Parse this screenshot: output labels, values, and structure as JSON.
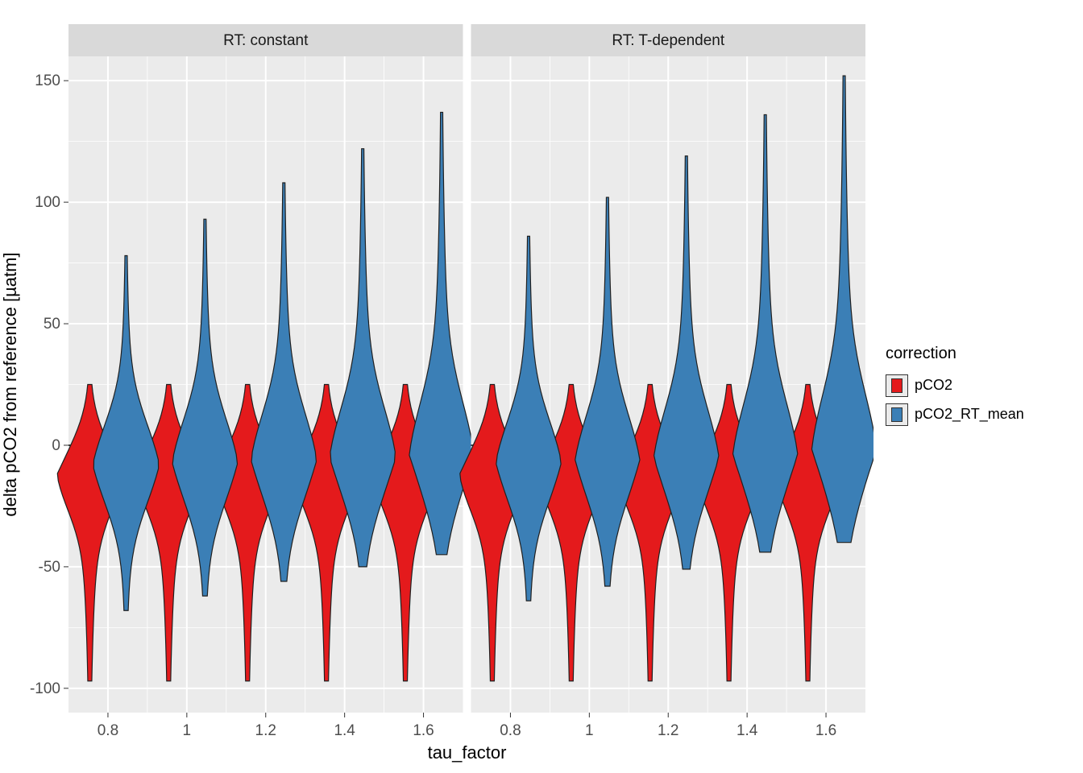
{
  "chart_data": {
    "type": "violin",
    "facets": [
      "RT: constant",
      "RT: T-dependent"
    ],
    "x_categories": [
      "0.8",
      "1",
      "1.2",
      "1.4",
      "1.6"
    ],
    "xlabel": "tau_factor",
    "ylabel": "delta pCO2 from reference [µatm]",
    "ylim": [
      -110,
      160
    ],
    "y_ticks": [
      -100,
      -50,
      0,
      50,
      100,
      150
    ],
    "legend_title": "correction",
    "series": [
      {
        "name": "pCO2",
        "color": "#e41a1c"
      },
      {
        "name": "pCO2_RT_mean",
        "color": "#3b7fb6"
      }
    ],
    "violins": {
      "RT: constant": {
        "pCO2": [
          {
            "x": "0.8",
            "range": [
              -97,
              25
            ],
            "median": -10,
            "peak": -12
          },
          {
            "x": "1",
            "range": [
              -97,
              25
            ],
            "median": -10,
            "peak": -12
          },
          {
            "x": "1.2",
            "range": [
              -97,
              25
            ],
            "median": -10,
            "peak": -12
          },
          {
            "x": "1.4",
            "range": [
              -97,
              25
            ],
            "median": -10,
            "peak": -12
          },
          {
            "x": "1.6",
            "range": [
              -97,
              25
            ],
            "median": -10,
            "peak": -12
          }
        ],
        "pCO2_RT_mean": [
          {
            "x": "0.8",
            "range": [
              -68,
              78
            ],
            "median": -8,
            "peak": -8
          },
          {
            "x": "1",
            "range": [
              -62,
              93
            ],
            "median": -7,
            "peak": -7
          },
          {
            "x": "1.2",
            "range": [
              -56,
              108
            ],
            "median": -6,
            "peak": -6
          },
          {
            "x": "1.4",
            "range": [
              -50,
              122
            ],
            "median": -5,
            "peak": -5
          },
          {
            "x": "1.6",
            "range": [
              -45,
              137
            ],
            "median": -4,
            "peak": -4
          }
        ]
      },
      "RT: T-dependent": {
        "pCO2": [
          {
            "x": "0.8",
            "range": [
              -97,
              25
            ],
            "median": -10,
            "peak": -12
          },
          {
            "x": "1",
            "range": [
              -97,
              25
            ],
            "median": -10,
            "peak": -12
          },
          {
            "x": "1.2",
            "range": [
              -97,
              25
            ],
            "median": -10,
            "peak": -12
          },
          {
            "x": "1.4",
            "range": [
              -97,
              25
            ],
            "median": -10,
            "peak": -12
          },
          {
            "x": "1.6",
            "range": [
              -97,
              25
            ],
            "median": -10,
            "peak": -12
          }
        ],
        "pCO2_RT_mean": [
          {
            "x": "0.8",
            "range": [
              -64,
              86
            ],
            "median": -7,
            "peak": -7
          },
          {
            "x": "1",
            "range": [
              -58,
              102
            ],
            "median": -6,
            "peak": -6
          },
          {
            "x": "1.2",
            "range": [
              -51,
              119
            ],
            "median": -5,
            "peak": -5
          },
          {
            "x": "1.4",
            "range": [
              -44,
              136
            ],
            "median": -4,
            "peak": -4
          },
          {
            "x": "1.6",
            "range": [
              -40,
              152
            ],
            "median": -3,
            "peak": -2
          }
        ]
      }
    }
  }
}
